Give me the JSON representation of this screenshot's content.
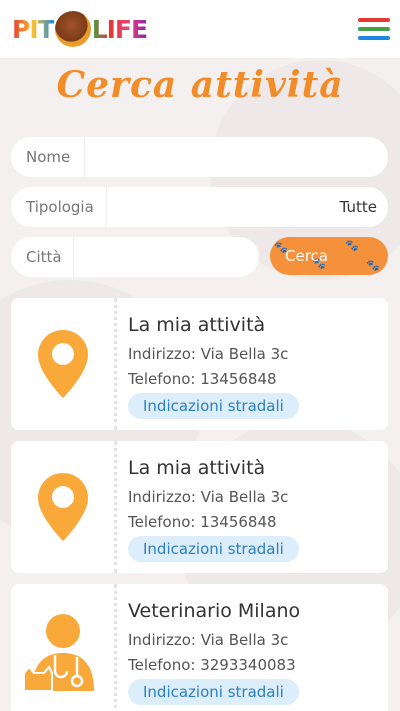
{
  "brand": {
    "logo_left": "PIT",
    "logo_right": "LIFE"
  },
  "colors": {
    "accent": "#f28c28",
    "button": "#f5913a",
    "pin": "#f9a83a",
    "link_bg": "#dceefa",
    "link_text": "#2c7fc1"
  },
  "page": {
    "title": "Cerca attività"
  },
  "search": {
    "name_label": "Nome",
    "type_label": "Tipologia",
    "type_value": "Tutte",
    "city_label": "Città",
    "submit_label": "Cerca"
  },
  "results": [
    {
      "icon": "location-pin-icon",
      "name": "La mia attività",
      "address": "Indirizzo: Via Bella 3c",
      "phone": "Telefono: 13456848",
      "directions": "Indicazioni stradali"
    },
    {
      "icon": "location-pin-icon",
      "name": "La mia attività",
      "address": "Indirizzo: Via Bella 3c",
      "phone": "Telefono: 13456848",
      "directions": "Indicazioni stradali"
    },
    {
      "icon": "veterinarian-icon",
      "name": "Veterinario Milano",
      "address": "Indirizzo: Via Bella 3c",
      "phone": "Telefono: 3293340083",
      "directions": "Indicazioni stradali"
    }
  ]
}
